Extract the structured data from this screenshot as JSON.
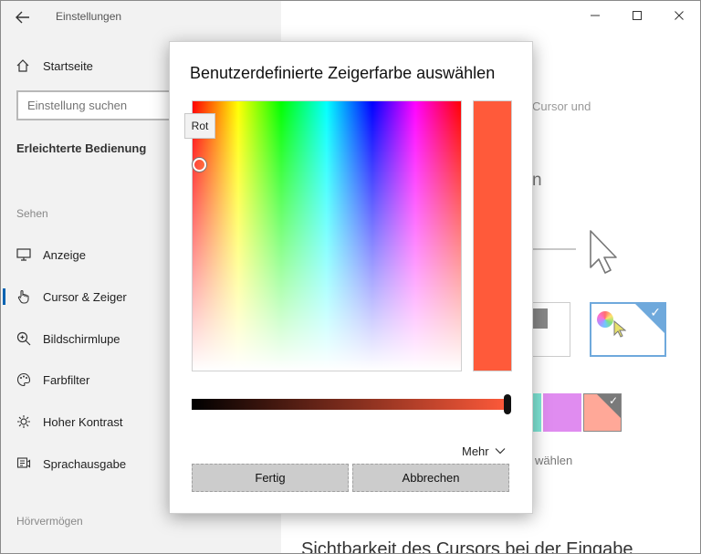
{
  "window": {
    "title": "Einstellungen"
  },
  "sidebar": {
    "home_label": "Startseite",
    "search_placeholder": "Einstellung suchen",
    "section_title": "Erleichterte Bedienung",
    "groups": {
      "see": "Sehen",
      "hear": "Hörvermögen"
    },
    "items": [
      {
        "label": "Anzeige",
        "icon": "monitor-icon"
      },
      {
        "label": "Cursor & Zeiger",
        "icon": "pointer-hand-icon",
        "active": true
      },
      {
        "label": "Bildschirmlupe",
        "icon": "magnifier-icon"
      },
      {
        "label": "Farbfilter",
        "icon": "palette-icon"
      },
      {
        "label": "Hoher Kontrast",
        "icon": "brightness-icon"
      },
      {
        "label": "Sprachausgabe",
        "icon": "narrator-icon"
      }
    ]
  },
  "main": {
    "partial_text_1": "Cursor und",
    "partial_text_2": "n",
    "partial_text_3": "wählen",
    "bottom_heading": "Sichtbarkeit des Cursors bei der Eingabe",
    "swatch_colors": [
      "#7fe8d8",
      "#e08cf0",
      "#ffa898"
    ]
  },
  "dialog": {
    "title": "Benutzerdefinierte Zeigerfarbe auswählen",
    "tooltip": "Rot",
    "selected_color": "#ff5a3a",
    "brightness_percent": 100,
    "more_label": "Mehr",
    "done_label": "Fertig",
    "cancel_label": "Abbrechen"
  }
}
